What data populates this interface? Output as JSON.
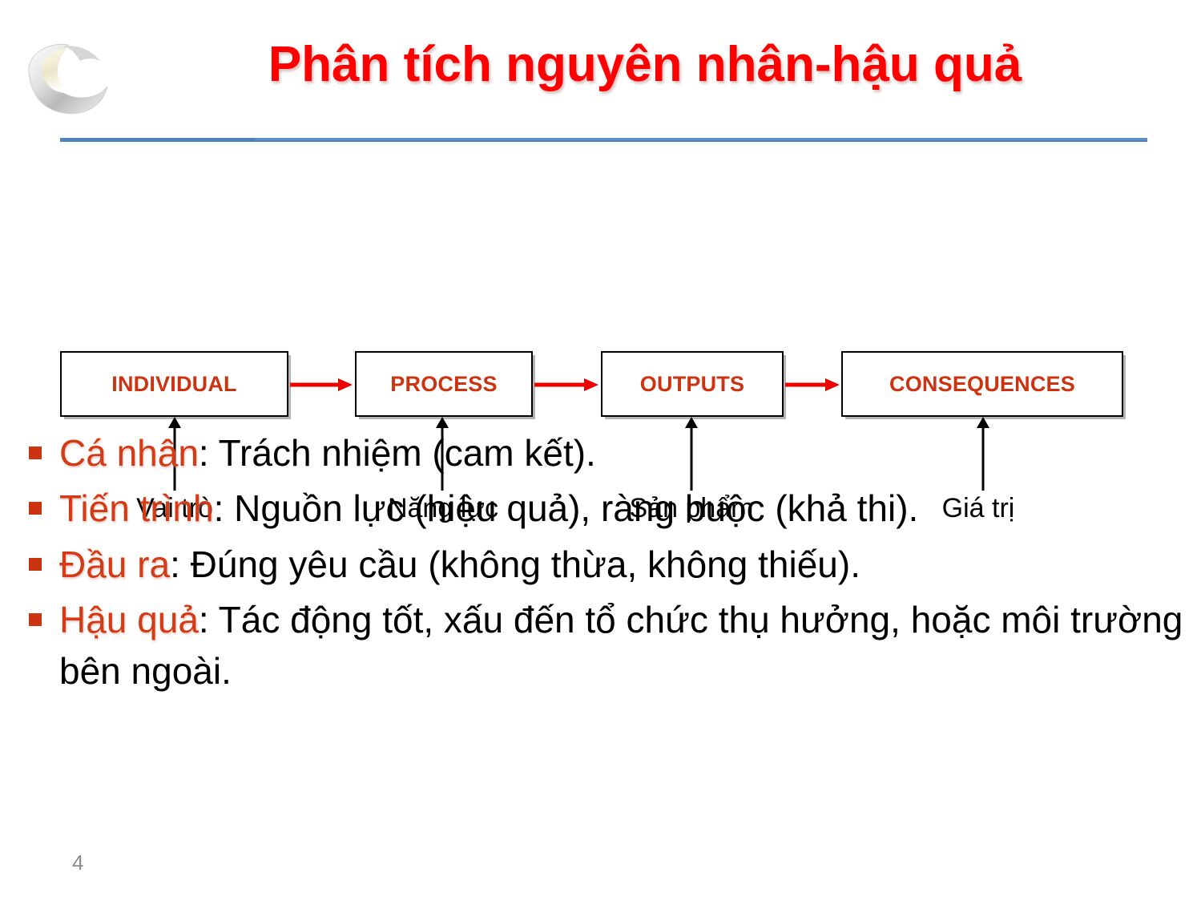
{
  "slide": {
    "title": "Phân tích nguyên nhân-hậu quả",
    "page_number": "4",
    "title_color": "#FF0000",
    "accent_color": "#CC3311",
    "divider_color": "#4F81BD",
    "arrow_color_horizontal": "#EE0000",
    "arrow_color_vertical": "#000000",
    "logo_name": "crescent-swoosh-logo"
  },
  "diagram": {
    "boxes": [
      {
        "label": "INDIVIDUAL"
      },
      {
        "label": "PROCESS"
      },
      {
        "label": "OUTPUTS"
      },
      {
        "label": "CONSEQUENCES"
      }
    ],
    "captions": [
      {
        "label": "Vai trò"
      },
      {
        "label": "Năng lực"
      },
      {
        "label": "Sản phẩm"
      },
      {
        "label": "Giá trị"
      }
    ]
  },
  "bullets": [
    {
      "lead": "Cá nhân",
      "rest": ": Trách nhiệm (cam kết)."
    },
    {
      "lead": "Tiến trình",
      "rest": ": Nguồn lực (hiệu quả), ràng buộc (khả thi)."
    },
    {
      "lead": "Đầu ra",
      "rest": ": Đúng yêu cầu (không thừa, không thiếu)."
    },
    {
      "lead": "Hậu quả",
      "rest": ": Tác động tốt, xấu đến tổ chức thụ hưởng, hoặc môi trường bên ngoài."
    }
  ]
}
